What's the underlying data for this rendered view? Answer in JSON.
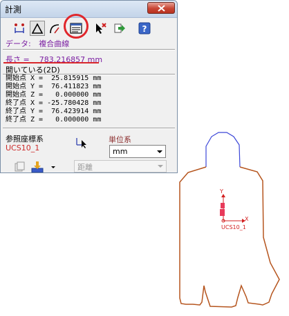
{
  "window": {
    "title": "計測"
  },
  "toolbar": {
    "buttons": [
      {
        "icon": "measure-distance-icon",
        "pressed": false
      },
      {
        "icon": "measure-triangle-icon",
        "pressed": true
      },
      {
        "icon": "measure-angle-icon",
        "pressed": false
      },
      {
        "icon": "entity-info-icon",
        "pressed": false
      },
      {
        "icon": "select-cancel-icon",
        "pressed": false
      },
      {
        "icon": "export-icon",
        "pressed": false
      },
      {
        "icon": "help-icon",
        "pressed": false
      }
    ]
  },
  "info": {
    "data_label": "データ:",
    "data_value": "複合曲線",
    "length_text": "長さ =    783.216857 mm",
    "open_text": "開いている(2D)"
  },
  "coords": [
    "開始点 X =  25.815915 mm",
    "開始点 Y =  76.411823 mm",
    "開始点 Z =   0.000000 mm",
    "終了点 X = -25.780428 mm",
    "終了点 Y =  76.423914 mm",
    "終了点 Z =   0.000000 mm"
  ],
  "reference": {
    "label": "参照座標系",
    "ucs_name": "UCS10_1"
  },
  "unit": {
    "label": "単位系",
    "value": "mm"
  },
  "distance": {
    "value": "距離"
  },
  "canvas": {
    "axis_x": "X",
    "axis_y": "Y",
    "ucs_label": "UCS10_1",
    "colors": {
      "outline": "#b5541d",
      "highlight": "#3b46d8",
      "axis": "#d32020"
    }
  }
}
